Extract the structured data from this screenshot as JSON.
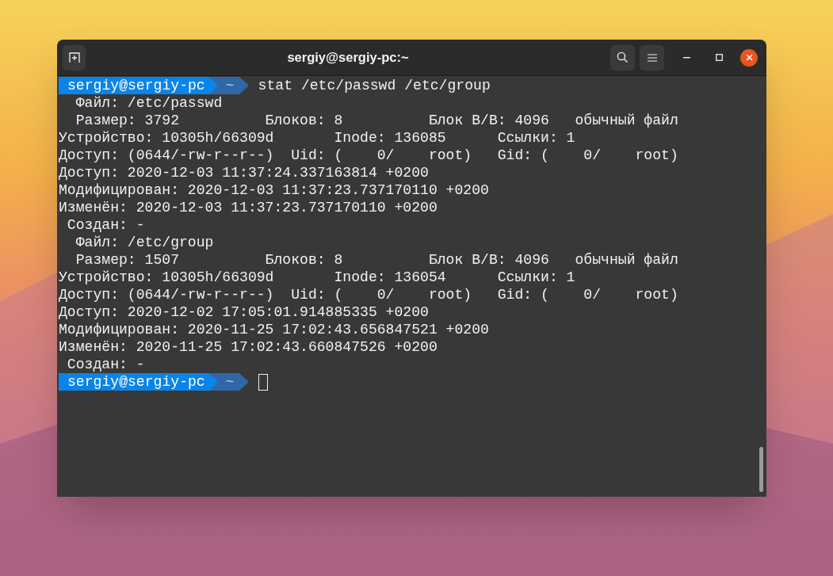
{
  "window": {
    "title": "sergiy@sergiy-pc:~"
  },
  "terminal": {
    "lines": [
      {
        "kind": "prompt",
        "user_host": "sergiy@sergiy-pc",
        "dir": "~",
        "command": "stat /etc/passwd /etc/group",
        "cursor": false
      },
      {
        "kind": "output",
        "text": "  Файл: /etc/passwd"
      },
      {
        "kind": "output",
        "text": "  Размер: 3792          Блоков: 8          Блок В/В: 4096   обычный файл"
      },
      {
        "kind": "output",
        "text": "Устройство: 10305h/66309d       Inode: 136085      Ссылки: 1"
      },
      {
        "kind": "output",
        "text": "Доступ: (0644/-rw-r--r--)  Uid: (    0/    root)   Gid: (    0/    root)"
      },
      {
        "kind": "output",
        "text": "Доступ: 2020-12-03 11:37:24.337163814 +0200"
      },
      {
        "kind": "output",
        "text": "Модифицирован: 2020-12-03 11:37:23.737170110 +0200"
      },
      {
        "kind": "output",
        "text": "Изменён: 2020-12-03 11:37:23.737170110 +0200"
      },
      {
        "kind": "output",
        "text": " Создан: -"
      },
      {
        "kind": "output",
        "text": "  Файл: /etc/group"
      },
      {
        "kind": "output",
        "text": "  Размер: 1507          Блоков: 8          Блок В/В: 4096   обычный файл"
      },
      {
        "kind": "output",
        "text": "Устройство: 10305h/66309d       Inode: 136054      Ссылки: 1"
      },
      {
        "kind": "output",
        "text": "Доступ: (0644/-rw-r--r--)  Uid: (    0/    root)   Gid: (    0/    root)"
      },
      {
        "kind": "output",
        "text": "Доступ: 2020-12-02 17:05:01.914885335 +0200"
      },
      {
        "kind": "output",
        "text": "Модифицирован: 2020-11-25 17:02:43.656847521 +0200"
      },
      {
        "kind": "output",
        "text": "Изменён: 2020-11-25 17:02:43.660847526 +0200"
      },
      {
        "kind": "output",
        "text": " Создан: -"
      },
      {
        "kind": "prompt",
        "user_host": "sergiy@sergiy-pc",
        "dir": "~",
        "cursor": true
      }
    ]
  }
}
